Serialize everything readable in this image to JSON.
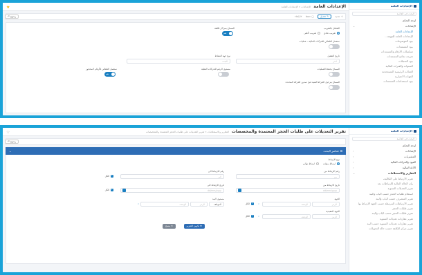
{
  "screen1": {
    "sidebar": {
      "head": "الإعدادات العامة",
      "search_placeholder": "البحث في القائمة",
      "items": [
        {
          "label": "لوحة التحكم",
          "type": "top"
        },
        {
          "label": "الإعدادات",
          "type": "top",
          "chev": "⌄"
        },
        {
          "label": "الإعدادات العامة",
          "type": "active"
        },
        {
          "label": "الإعدادات العامة للمهمة...",
          "type": "sub"
        },
        {
          "label": "بنود الموضوعات",
          "type": "sub"
        },
        {
          "label": "بنود المستندات",
          "type": "sub"
        },
        {
          "label": "تسلسلات الارقام والمستندات",
          "type": "sub"
        },
        {
          "label": "تعريف نماذج المستندات",
          "type": "sub"
        },
        {
          "label": "بنود السجلات",
          "type": "sub"
        },
        {
          "label": "السنوات والفترات المالية",
          "type": "sub"
        },
        {
          "label": "العملات الرئيسية المستخدمة",
          "type": "sub"
        },
        {
          "label": "الجهات الاعتبارية",
          "type": "sub"
        },
        {
          "label": "بنود استخدامات المستندات",
          "type": "sub"
        }
      ]
    },
    "topbar": {
      "title": "الإعدادات العامة",
      "crumb": "الإعدادات  »  الإعدادات العامة"
    },
    "toolbar": {
      "new": "جديد",
      "edit": "تعديل",
      "save": "حفظ",
      "cancel": "إلغاء",
      "back": "رجوع"
    },
    "form": {
      "rounding_label": "التعامل بالتقريب",
      "opt_normal": "تقريب عادي",
      "opt_up": "تقريب لأعلى",
      "multi_centers_label": "السماح بمراكز تكلفة",
      "auto_post_label": "ستعمل التلقائي للحركات المالية - عمليات",
      "activation_label": "تاريخ التفعيل",
      "activity_label": "نوع جهة النشاط",
      "neg_stock_label": "السماح بحفظ العمليات",
      "prev_move_label": "مستوى الرقم للحركات النقلية",
      "auto_reserve_label": "ستعمل التلقائي للأرقام المحجوز",
      "delete_move_label": "السماح بترحيل الحركة الفنية قبل تمدين الحركة المحددة",
      "toggle_on": "نعم",
      "placeholder_general": "اختر",
      "placeholder_search": "البحث"
    }
  },
  "screen2": {
    "sidebar": {
      "head": "الإعدادات العامة",
      "search_placeholder": "البحث في القائمة",
      "items": [
        {
          "label": "لوحة التحكم",
          "type": "top"
        },
        {
          "label": "الإعدادات",
          "type": "top",
          "chev": "‹"
        },
        {
          "label": "المشتريات",
          "type": "top",
          "chev": "‹"
        },
        {
          "label": "القيود والحركات المالية",
          "type": "top",
          "chev": "‹"
        },
        {
          "label": "الأدلة المالية",
          "type": "top",
          "chev": "‹"
        },
        {
          "label": "التقارير والاستعلامات",
          "type": "bold",
          "chev": "⌄"
        },
        {
          "label": "تقرير الارتباط على التكاليف",
          "type": "sub"
        },
        {
          "label": "بيان الحالة المالية للارتباطات بعد",
          "type": "sub"
        },
        {
          "label": "تقرير التعديلات السنوية",
          "type": "sub"
        },
        {
          "label": "استعلام طلبات الحجز حسب الباب والبند",
          "type": "sub"
        },
        {
          "label": "تقرير المنصرف حسب الباب والبند",
          "type": "sub"
        },
        {
          "label": "تقرير الارتباطات المرتبطة حسب الجهة الارتباط بها",
          "type": "sub"
        },
        {
          "label": "تقرير طلبات الحجز",
          "type": "sub"
        },
        {
          "label": "تقرير طلبات الحجز حسب الباب والبند",
          "type": "sub"
        },
        {
          "label": "تقرير مقارنات تعديلات السنوية",
          "type": "sub"
        },
        {
          "label": "تقرير مقارنات تعديلات السنوية حسب البند",
          "type": "sub"
        },
        {
          "label": "تقرير مركز التكلفة حسب حالة التحويلات",
          "type": "sub"
        }
      ]
    },
    "topbar": {
      "title": "تقرير التعديلات على طلبات الحجز المعتمدة والمخصصات",
      "crumb": "التقارير والاستعلامات  »  تقرير التعديلات على طلبات الحجز المعتمدة والمخصصات"
    },
    "toolbar": {
      "back": "رجوع"
    },
    "filter_header": "عناصر البحث",
    "form": {
      "reservation_type_label": "نوع الارتباط",
      "opt_temp": "ارتباط مؤقت",
      "opt_final": "ارتباط نهائي",
      "from_number_label": "رقم الارتباط من",
      "to_number_label": "رقم الارتباط الى",
      "from_date_label": "تاريخ الارتباط من",
      "to_date_label": "تاريخ الارتباط الى",
      "entity_label": "الجهة",
      "budget_label": "مستوى البند",
      "side_label": "الجهة التنفيذية",
      "all_label": "الكل",
      "placeholder_from": "من",
      "placeholder_to": "الى",
      "placeholder_code": "الرمز",
      "placeholder_desc": "الوصف",
      "placeholder_date": "dd/mm/yyyy",
      "level_value": "الموظف"
    },
    "buttons": {
      "show": "تكوين التقرير",
      "clear": "مسح"
    }
  }
}
